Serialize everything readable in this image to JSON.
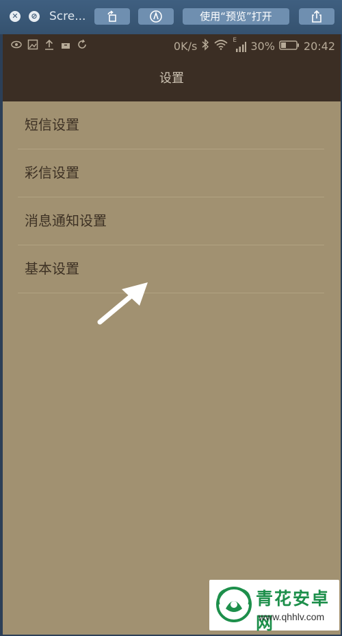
{
  "toolbar": {
    "title": "Scre...",
    "open_with_label": "使用“预览”打开"
  },
  "statusbar": {
    "net_speed": "0K/s",
    "signal_tag": "E",
    "battery": "30%",
    "time": "20:42"
  },
  "page": {
    "title": "设置"
  },
  "settings": {
    "items": [
      {
        "label": "短信设置"
      },
      {
        "label": "彩信设置"
      },
      {
        "label": "消息通知设置"
      },
      {
        "label": "基本设置"
      }
    ]
  },
  "watermark": {
    "name": "青花安卓网",
    "url": "www.qhhlv.com"
  },
  "colors": {
    "header": "#3b2e24",
    "background": "#a19171",
    "text": "#3d3124",
    "arrow": "#ffffff"
  }
}
